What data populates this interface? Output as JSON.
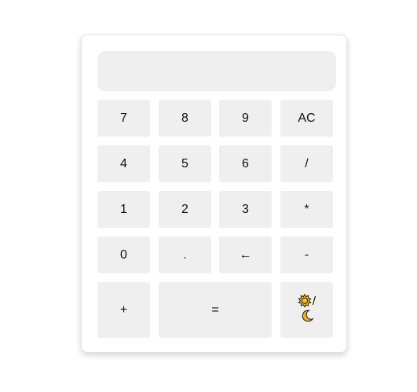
{
  "display": {
    "value": ""
  },
  "keys": {
    "k7": "7",
    "k8": "8",
    "k9": "9",
    "clear": "AC",
    "k4": "4",
    "k5": "5",
    "k6": "6",
    "divide": "/",
    "k1": "1",
    "k2": "2",
    "k3": "3",
    "multiply": "*",
    "k0": "0",
    "decimal": ".",
    "backspace": "←",
    "subtract": "-",
    "add": "+",
    "equals": "=",
    "theme_separator": "/"
  },
  "icons": {
    "sun": "sun-icon",
    "moon": "moon-icon"
  },
  "colors": {
    "key_background": "#efefef",
    "sun": "#f7c325",
    "moon": "#f2b233"
  }
}
